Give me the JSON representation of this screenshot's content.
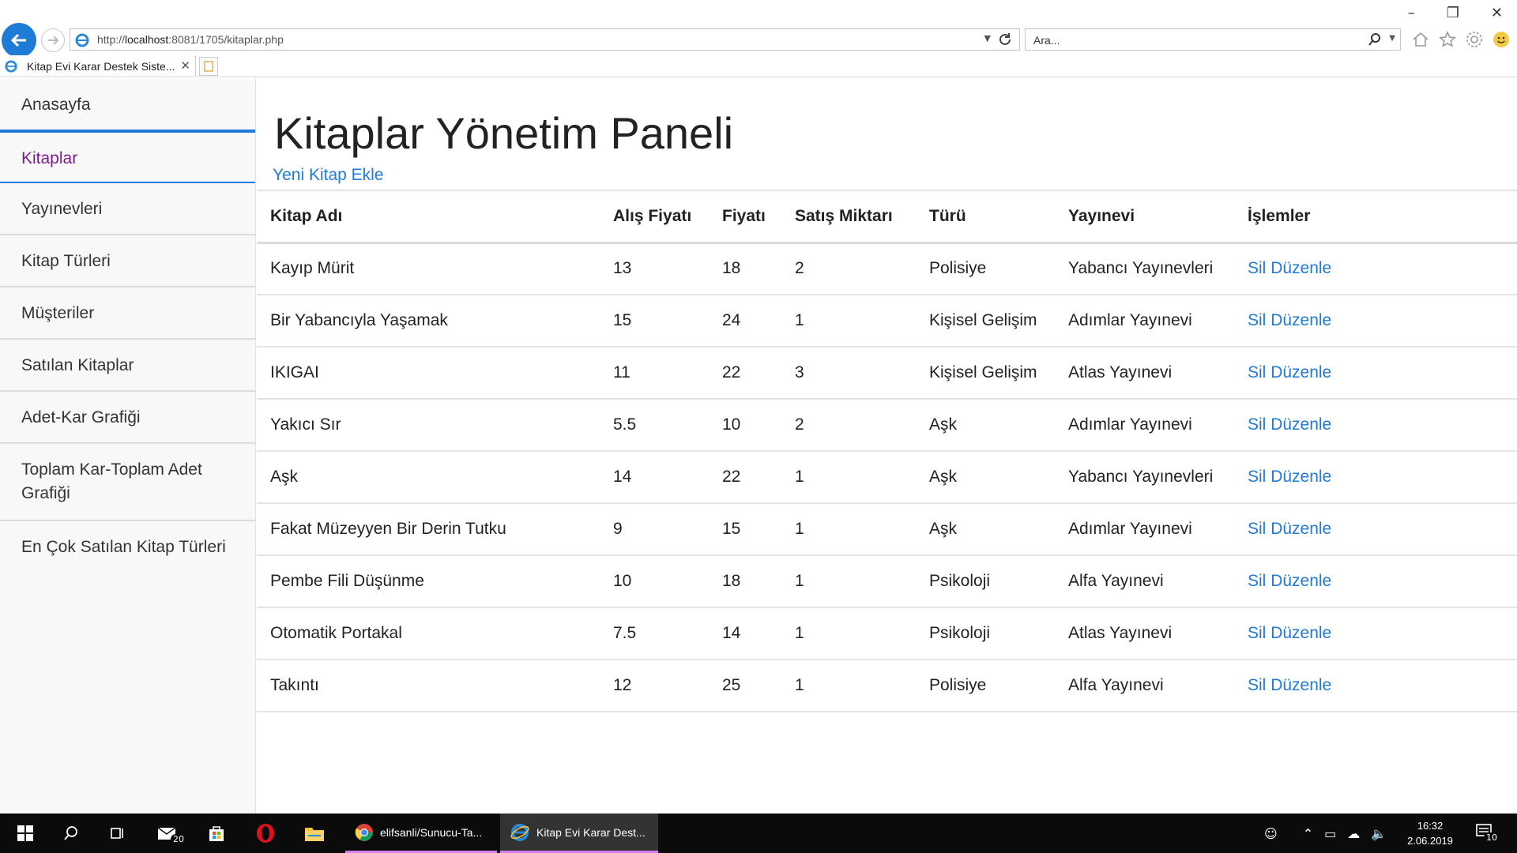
{
  "browser": {
    "url_prefix": "http://",
    "url_host": "localhost",
    "url_rest": ":8081/1705/kitaplar.php",
    "search_placeholder": "Ara...",
    "tab_title": "Kitap Evi Karar Destek Siste..."
  },
  "sidebar": {
    "items": [
      {
        "label": "Anasayfa"
      },
      {
        "label": "Kitaplar"
      },
      {
        "label": "Yayınevleri"
      },
      {
        "label": "Kitap Türleri"
      },
      {
        "label": "Müşteriler"
      },
      {
        "label": "Satılan Kitaplar"
      },
      {
        "label": "Adet-Kar Grafiği"
      },
      {
        "label": "Toplam Kar-Toplam Adet Grafiği"
      },
      {
        "label": "En Çok Satılan Kitap Türleri"
      }
    ]
  },
  "main": {
    "title": "Kitaplar Yönetim Paneli",
    "add_link": "Yeni Kitap Ekle",
    "columns": [
      "Kitap Adı",
      "Alış Fiyatı",
      "Fiyatı",
      "Satış Miktarı",
      "Türü",
      "Yayınevi",
      "İşlemler"
    ],
    "delete_label": "Sil",
    "edit_label": "Düzenle",
    "rows": [
      {
        "name": "Kayıp Mürit",
        "buy": "13",
        "price": "18",
        "qty": "2",
        "genre": "Polisiye",
        "publisher": "Yabancı Yayınevleri"
      },
      {
        "name": "Bir Yabancıyla Yaşamak",
        "buy": "15",
        "price": "24",
        "qty": "1",
        "genre": "Kişisel Gelişim",
        "publisher": "Adımlar Yayınevi"
      },
      {
        "name": "IKIGAI",
        "buy": "11",
        "price": "22",
        "qty": "3",
        "genre": "Kişisel Gelişim",
        "publisher": "Atlas Yayınevi"
      },
      {
        "name": "Yakıcı Sır",
        "buy": "5.5",
        "price": "10",
        "qty": "2",
        "genre": "Aşk",
        "publisher": "Adımlar Yayınevi"
      },
      {
        "name": "Aşk",
        "buy": "14",
        "price": "22",
        "qty": "1",
        "genre": "Aşk",
        "publisher": "Yabancı Yayınevleri"
      },
      {
        "name": "Fakat Müzeyyen Bir Derin Tutku",
        "buy": "9",
        "price": "15",
        "qty": "1",
        "genre": "Aşk",
        "publisher": "Adımlar Yayınevi"
      },
      {
        "name": "Pembe Fili Düşünme",
        "buy": "10",
        "price": "18",
        "qty": "1",
        "genre": "Psikoloji",
        "publisher": "Alfa Yayınevi"
      },
      {
        "name": "Otomatik Portakal",
        "buy": "7.5",
        "price": "14",
        "qty": "1",
        "genre": "Psikoloji",
        "publisher": "Atlas Yayınevi"
      },
      {
        "name": "Takıntı",
        "buy": "12",
        "price": "25",
        "qty": "1",
        "genre": "Polisiye",
        "publisher": "Alfa Yayınevi"
      }
    ]
  },
  "taskbar": {
    "mail_badge": "20",
    "chrome_label": "elifsanli/Sunucu-Ta...",
    "ie_label": "Kitap Evi Karar Dest...",
    "time": "16:32",
    "date": "2.06.2019",
    "notif_badge": "10"
  },
  "colors": {
    "accent": "#1e7bd6",
    "active_nav": "#7a1f8a",
    "taskbar": "#0b0b0b"
  }
}
